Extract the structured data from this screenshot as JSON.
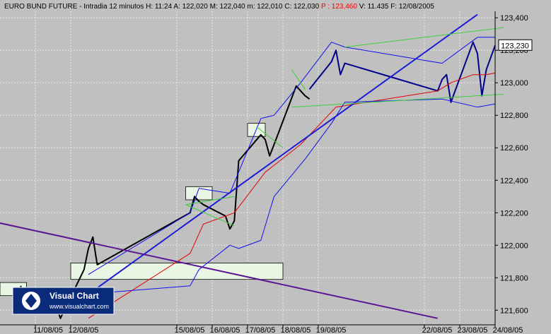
{
  "header": {
    "instrument": "EURO BUND FUTURE",
    "timeframe": "Intradia 12 minutos",
    "fields": [
      {
        "label": "H:",
        "value": "11:24"
      },
      {
        "label": "A:",
        "value": "122,020"
      },
      {
        "label": "M:",
        "value": "122,040"
      },
      {
        "label": "m:",
        "value": "122,010"
      },
      {
        "label": "C:",
        "value": "122,030"
      },
      {
        "label": "P :",
        "value": "123,460",
        "highlight": true
      },
      {
        "label": "V:",
        "value": "11.435"
      },
      {
        "label": "F:",
        "value": "12/08/2005"
      }
    ]
  },
  "watermark": {
    "brand": "Visual Chart",
    "url": "www.visualchart.com"
  },
  "colors": {
    "background": "#c0c0c0",
    "grid": "#e8e8e8",
    "price": "#000000",
    "price_recent": "#00008b",
    "bollinger": "#1010ee",
    "moving_average": "#e00000",
    "trendline_up": "#1c1cd8",
    "trendline_down": "#5a1496",
    "channel": "#3ccf3c",
    "highlight_text": "#ff0000"
  },
  "chart_data": {
    "type": "line",
    "title": "EURO BUND FUTURE - Intradia 12 minutos",
    "y_ticks": [
      "123,400",
      "123,200",
      "123,000",
      "122,800",
      "122,600",
      "122,400",
      "122,200",
      "122,000",
      "121,800",
      "121,600"
    ],
    "ylim": [
      121.51,
      123.44
    ],
    "x_ticks": [
      "11/08/05",
      "12/08/05",
      "15/08/05",
      "16/08/05",
      "17/08/05",
      "18/08/05",
      "19/08/05",
      "22/08/05",
      "23/08/05",
      "24/08/05"
    ],
    "x_range": [
      "2005-08-10",
      "2005-08-24"
    ],
    "last_price_label": "123,230",
    "grid": true,
    "series": [
      {
        "key": "price",
        "points": [
          [
            "2005-08-10T14:00",
            121.75
          ],
          [
            "2005-08-10T16:00",
            121.68
          ],
          [
            "2005-08-11T10:00",
            121.58
          ],
          [
            "2005-08-11T14:00",
            121.63
          ],
          [
            "2005-08-11T17:00",
            121.55
          ],
          [
            "2005-08-12T09:00",
            121.85
          ],
          [
            "2005-08-12T12:00",
            121.98
          ],
          [
            "2005-08-12T15:00",
            122.05
          ],
          [
            "2005-08-12T18:00",
            121.88
          ],
          [
            "2005-08-15T09:00",
            122.2
          ],
          [
            "2005-08-15T12:00",
            122.3
          ],
          [
            "2005-08-15T15:00",
            122.27
          ],
          [
            "2005-08-15T18:00",
            122.25
          ],
          [
            "2005-08-16T09:00",
            122.18
          ],
          [
            "2005-08-16T12:00",
            122.1
          ],
          [
            "2005-08-16T15:00",
            122.15
          ],
          [
            "2005-08-16T18:00",
            122.52
          ],
          [
            "2005-08-17T09:00",
            122.68
          ],
          [
            "2005-08-17T12:00",
            122.65
          ],
          [
            "2005-08-17T15:00",
            122.55
          ],
          [
            "2005-08-17T18:00",
            122.62
          ],
          [
            "2005-08-18T09:00",
            122.98
          ],
          [
            "2005-08-18T12:00",
            122.95
          ],
          [
            "2005-08-18T15:00",
            122.92
          ],
          [
            "2005-08-18T18:00",
            122.9
          ]
        ]
      },
      {
        "key": "price_recent",
        "points": [
          [
            "2005-08-18T18:00",
            122.96
          ],
          [
            "2005-08-19T09:00",
            123.13
          ],
          [
            "2005-08-19T12:00",
            123.2
          ],
          [
            "2005-08-19T15:00",
            123.05
          ],
          [
            "2005-08-19T18:00",
            123.12
          ],
          [
            "2005-08-22T09:00",
            122.95
          ],
          [
            "2005-08-22T12:00",
            123.02
          ],
          [
            "2005-08-22T15:00",
            123.05
          ],
          [
            "2005-08-22T18:00",
            122.88
          ],
          [
            "2005-08-23T09:00",
            123.25
          ],
          [
            "2005-08-23T12:00",
            123.18
          ],
          [
            "2005-08-23T15:00",
            122.92
          ],
          [
            "2005-08-23T18:00",
            123.08
          ],
          [
            "2005-08-24T00:00",
            123.23
          ]
        ]
      },
      {
        "key": "moving_average",
        "points": [
          [
            "2005-08-12T12:00",
            121.55
          ],
          [
            "2005-08-15T09:00",
            121.95
          ],
          [
            "2005-08-15T18:00",
            122.13
          ],
          [
            "2005-08-16T15:00",
            122.2
          ],
          [
            "2005-08-17T12:00",
            122.45
          ],
          [
            "2005-08-18T12:00",
            122.62
          ],
          [
            "2005-08-19T12:00",
            122.85
          ],
          [
            "2005-08-22T09:00",
            122.95
          ],
          [
            "2005-08-22T18:00",
            123.0
          ],
          [
            "2005-08-23T09:00",
            123.05
          ],
          [
            "2005-08-23T18:00",
            123.05
          ],
          [
            "2005-08-24T00:00",
            123.06
          ]
        ]
      },
      {
        "key": "bollinger_upper",
        "points": [
          [
            "2005-08-12T12:00",
            121.82
          ],
          [
            "2005-08-15T09:00",
            122.2
          ],
          [
            "2005-08-15T15:00",
            122.35
          ],
          [
            "2005-08-16T12:00",
            122.32
          ],
          [
            "2005-08-17T09:00",
            122.78
          ],
          [
            "2005-08-17T18:00",
            122.8
          ],
          [
            "2005-08-18T12:00",
            123.0
          ],
          [
            "2005-08-19T09:00",
            123.25
          ],
          [
            "2005-08-19T18:00",
            123.22
          ],
          [
            "2005-08-22T12:00",
            123.12
          ],
          [
            "2005-08-23T12:00",
            123.28
          ],
          [
            "2005-08-24T00:00",
            123.28
          ]
        ]
      },
      {
        "key": "bollinger_lower",
        "points": [
          [
            "2005-08-12T12:00",
            121.7
          ],
          [
            "2005-08-15T09:00",
            121.75
          ],
          [
            "2005-08-15T15:00",
            121.85
          ],
          [
            "2005-08-16T12:00",
            122.0
          ],
          [
            "2005-08-16T18:00",
            121.98
          ],
          [
            "2005-08-17T09:00",
            122.03
          ],
          [
            "2005-08-17T18:00",
            122.3
          ],
          [
            "2005-08-18T15:00",
            122.53
          ],
          [
            "2005-08-19T09:00",
            122.75
          ],
          [
            "2005-08-19T18:00",
            122.88
          ],
          [
            "2005-08-22T12:00",
            122.9
          ],
          [
            "2005-08-23T12:00",
            122.85
          ],
          [
            "2005-08-24T00:00",
            122.87
          ]
        ]
      }
    ],
    "trendlines": [
      {
        "key": "trendline_up",
        "from": [
          "2005-08-12T00:00",
          121.62
        ],
        "to": [
          "2005-08-23T12:00",
          123.42
        ]
      },
      {
        "key": "trendline_down",
        "from": [
          "2005-08-09T12:00",
          122.16
        ],
        "to": [
          "2005-08-22T09:00",
          121.55
        ]
      },
      {
        "key": "channel",
        "from": [
          "2005-08-19T18:00",
          123.22
        ],
        "to": [
          "2005-08-24T06:00",
          123.34
        ]
      },
      {
        "key": "channel",
        "from": [
          "2005-08-18T06:00",
          122.85
        ],
        "to": [
          "2005-08-24T06:00",
          122.93
        ]
      },
      {
        "key": "channel",
        "from": [
          "2005-08-15T06:00",
          122.25
        ],
        "to": [
          "2005-08-16T15:00",
          122.12
        ]
      },
      {
        "key": "channel",
        "from": [
          "2005-08-15T06:00",
          122.25
        ],
        "to": [
          "2005-08-16T15:00",
          122.3
        ]
      },
      {
        "key": "channel",
        "from": [
          "2005-08-17T06:00",
          122.73
        ],
        "to": [
          "2005-08-18T00:00",
          122.6
        ]
      },
      {
        "key": "channel",
        "from": [
          "2005-08-18T06:00",
          123.08
        ],
        "to": [
          "2005-08-18T15:00",
          122.96
        ]
      }
    ],
    "boxes": [
      {
        "from": [
          "2005-08-12T00:00",
          121.86
        ],
        "to": [
          "2005-08-18T00:00",
          121.82
        ]
      },
      {
        "from": [
          "2005-08-15T06:00",
          122.33
        ],
        "to": [
          "2005-08-16T00:00",
          122.31
        ]
      },
      {
        "from": [
          "2005-08-17T00:00",
          122.72
        ],
        "to": [
          "2005-08-17T12:00",
          122.7
        ]
      },
      {
        "from": [
          "2005-08-10T00:00",
          121.74
        ],
        "to": [
          "2005-08-10T18:00",
          121.72
        ]
      }
    ]
  }
}
